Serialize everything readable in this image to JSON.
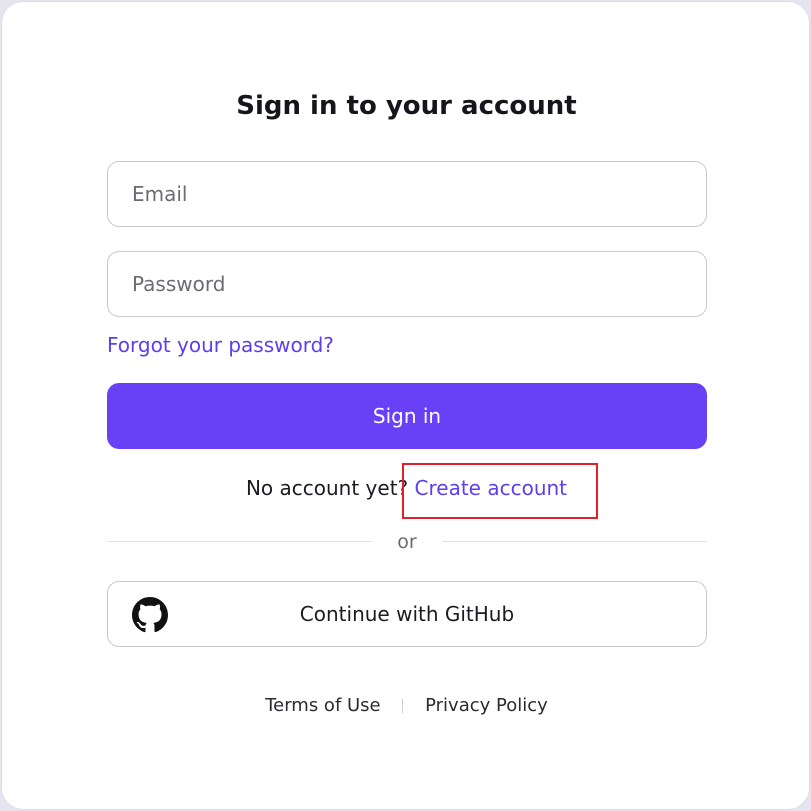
{
  "form": {
    "title": "Sign in to your account",
    "email_placeholder": "Email",
    "email_value": "",
    "password_placeholder": "Password",
    "password_value": "",
    "forgot_link": "Forgot your password?",
    "submit_label": "Sign in"
  },
  "signup": {
    "prompt": "No account yet?",
    "link_label": "Create account"
  },
  "divider": {
    "label": "or"
  },
  "oauth": {
    "github_label": "Continue with GitHub",
    "github_icon": "github-icon"
  },
  "footer": {
    "terms": "Terms of Use",
    "privacy": "Privacy Policy"
  },
  "colors": {
    "accent": "#6a40f7",
    "link": "#5b3ff0",
    "highlight": "#e0202a"
  }
}
